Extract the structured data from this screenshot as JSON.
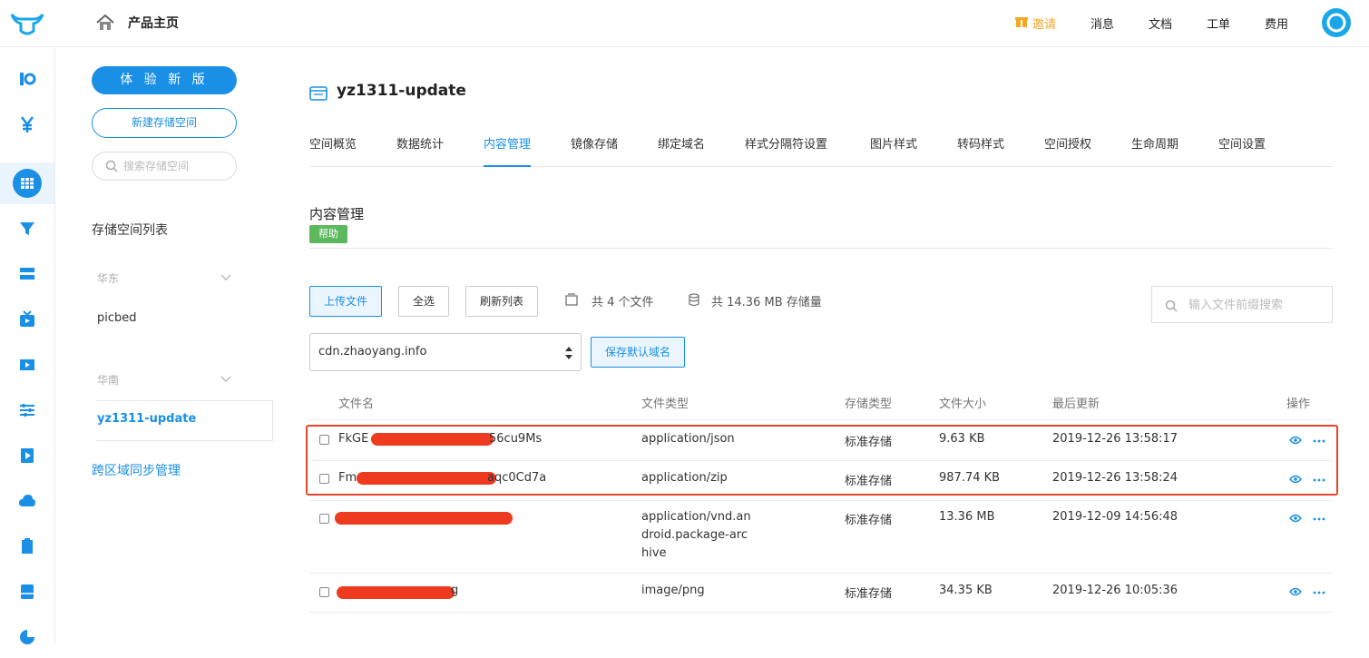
{
  "header": {
    "home_title": "产品主页",
    "nav": {
      "invite": "邀请",
      "messages": "消息",
      "docs": "文档",
      "tickets": "工单",
      "billing": "费用"
    }
  },
  "sidebar": {
    "try_new_version": "体 验 新 版",
    "new_bucket": "新建存储空间",
    "search_placeholder": "搜索存储空间",
    "bucket_list_title": "存储空间列表",
    "regions": [
      {
        "name": "华东",
        "buckets": [
          "picbed"
        ]
      },
      {
        "name": "华南",
        "buckets": [
          "yz1311-update"
        ]
      }
    ],
    "cross_region_sync": "跨区域同步管理"
  },
  "main": {
    "bucket_name": "yz1311-update",
    "tabs": [
      "空间概览",
      "数据统计",
      "内容管理",
      "镜像存储",
      "绑定域名",
      "样式分隔符设置",
      "图片样式",
      "转码样式",
      "空间授权",
      "生命周期",
      "空间设置"
    ],
    "active_tab": "内容管理",
    "section_title": "内容管理",
    "help_label": "帮助",
    "buttons": {
      "upload": "上传文件",
      "select_all": "全选",
      "refresh": "刷新列表",
      "save_domain": "保存默认域名"
    },
    "stats": {
      "file_count": "共 4 个文件",
      "storage": "共 14.36 MB 存储量"
    },
    "file_search_placeholder": "输入文件前缀搜索",
    "domain": "cdn.zhaoyang.info",
    "table": {
      "headers": [
        "文件名",
        "文件类型",
        "存储类型",
        "文件大小",
        "最后更新",
        "操作"
      ],
      "rows": [
        {
          "name_start": "FkGE",
          "name_end": "56cu9Ms",
          "type": "application/json",
          "storage": "标准存储",
          "size": "9.63 KB",
          "updated": "2019-12-26 13:58:17"
        },
        {
          "name_start": "Fm",
          "name_end": "aqc0Cd7a",
          "type": "application/zip",
          "storage": "标准存储",
          "size": "987.74 KB",
          "updated": "2019-12-26 13:58:24"
        },
        {
          "name_start": "",
          "name_end": "",
          "type_lines": [
            "application/vnd.an",
            "droid.package-arc",
            "hive"
          ],
          "storage": "标准存储",
          "size": "13.36 MB",
          "updated": "2019-12-09 14:56:48"
        },
        {
          "name_start": "",
          "name_end": "g",
          "type": "image/png",
          "storage": "标准存储",
          "size": "34.35 KB",
          "updated": "2019-12-26 10:05:36"
        }
      ]
    }
  },
  "colors": {
    "accent": "#1a8fe6",
    "help_green": "#5cb85c",
    "invite_orange": "#f5a623",
    "redact_red": "#ee3a1e",
    "highlight": "#e8432c"
  }
}
